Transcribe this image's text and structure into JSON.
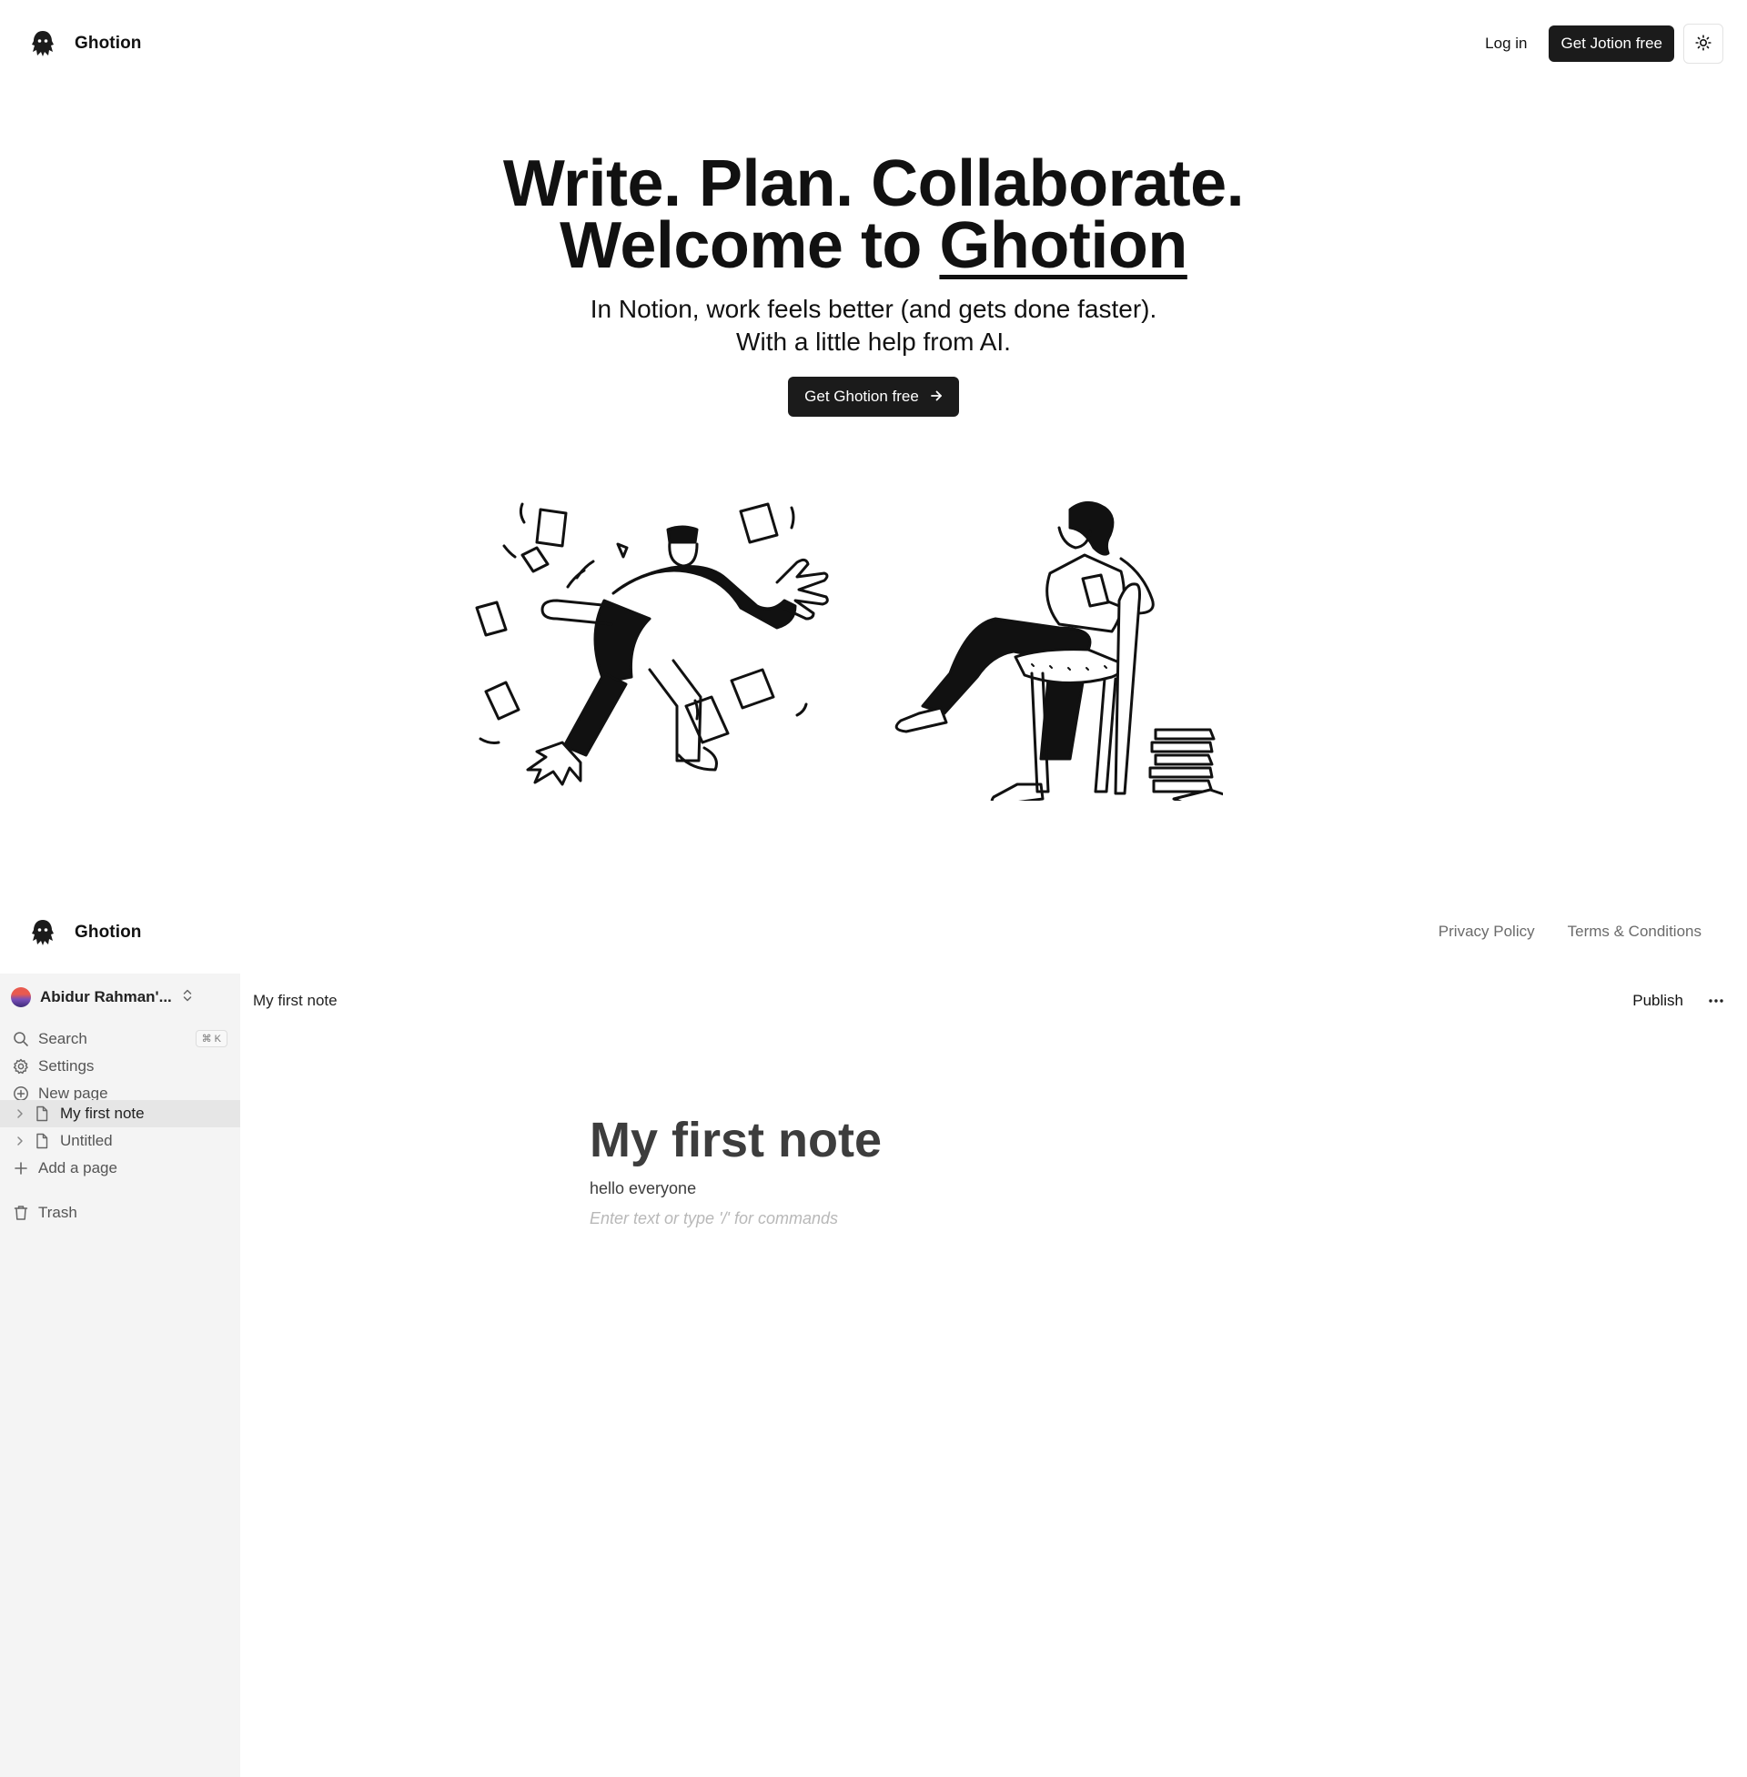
{
  "header": {
    "brand_name": "Ghotion",
    "login_label": "Log in",
    "cta_label": "Get Jotion free",
    "theme_icon": "sun-icon"
  },
  "hero": {
    "line1": "Write. Plan. Collaborate.",
    "line2_prefix": "Welcome to ",
    "line2_brand": "Ghotion",
    "sub1": "In Notion, work feels better (and gets done faster).",
    "sub2": "With a little help from AI.",
    "cta_label": "Get Ghotion free",
    "cta_icon": "arrow-right-icon"
  },
  "footer": {
    "brand_name": "Ghotion",
    "privacy": "Privacy Policy",
    "terms": "Terms & Conditions"
  },
  "sidebar": {
    "workspace_name": "Abidur Rahman'...",
    "search_label": "Search",
    "search_shortcut": "⌘ K",
    "settings_label": "Settings",
    "new_page_label": "New page",
    "pages": [
      {
        "label": "My first note",
        "active": true
      },
      {
        "label": "Untitled",
        "active": false
      }
    ],
    "add_page_label": "Add a page",
    "trash_label": "Trash"
  },
  "topbar": {
    "breadcrumb": "My first note",
    "publish_label": "Publish"
  },
  "editor": {
    "title": "My first note",
    "body": "hello everyone",
    "placeholder": "Enter text or type '/' for commands"
  }
}
